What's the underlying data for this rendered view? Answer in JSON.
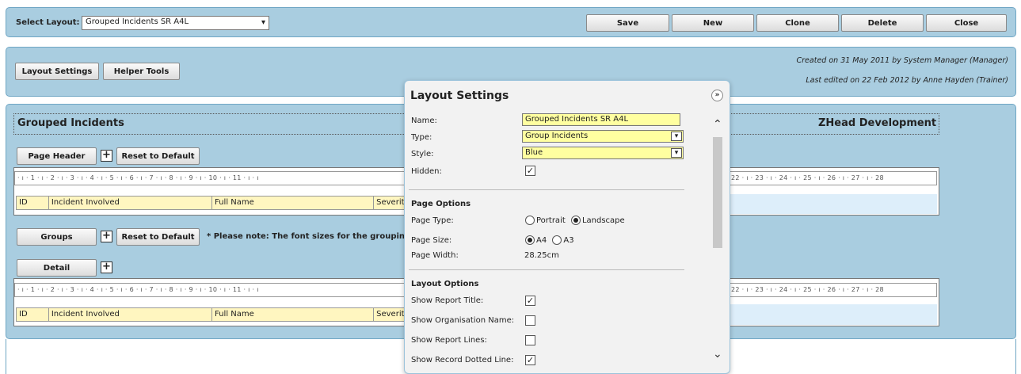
{
  "toolbar": {
    "select_layout_label": "Select Layout:",
    "select_layout_value": "Grouped Incidents SR A4L",
    "save": "Save",
    "new": "New",
    "clone": "Clone",
    "delete": "Delete",
    "close": "Close"
  },
  "info": {
    "layout_settings_btn": "Layout Settings",
    "helper_tools_btn": "Helper Tools",
    "created": "Created on 31 May 2011 by System Manager (Manager)",
    "edited": "Last edited on 22 Feb 2012 by Anne Hayden (Trainer)"
  },
  "report": {
    "title": "Grouped Incidents",
    "org": "ZHead Development",
    "page_header_btn": "Page Header",
    "reset_default": "Reset to Default",
    "groups_btn": "Groups",
    "groups_note": "* Please note: The font sizes for the grouping fi",
    "detail_btn": "Detail",
    "ruler_left": "· ı · 1 · ı · 2 · ı · 3 · ı · 4 · ı · 5 · ı · 6 · ı · 7 · ı · 8 · ı · 9 · ı · 10 · ı · 11 · ı · ı",
    "ruler_right": "22 · ı · 23 · ı · 24 · ı · 25 · ı · 26 · ı · 27 · ı · 28",
    "columns": [
      "ID",
      "Incident Involved",
      "Full Name",
      "Severity"
    ]
  },
  "dialog": {
    "title": "Layout Settings",
    "name_label": "Name:",
    "name_value": "Grouped Incidents SR A4L",
    "type_label": "Type:",
    "type_value": "Group Incidents",
    "style_label": "Style:",
    "style_value": "Blue",
    "hidden_label": "Hidden:",
    "page_options": "Page Options",
    "page_type_label": "Page Type:",
    "portrait": "Portrait",
    "landscape": "Landscape",
    "page_size_label": "Page Size:",
    "a4": "A4",
    "a3": "A3",
    "page_width_label": "Page Width:",
    "page_width_value": "28.25cm",
    "layout_options": "Layout Options",
    "show_report_title": "Show Report Title:",
    "show_org_name": "Show Organisation Name:",
    "show_report_lines": "Show Report Lines:",
    "show_record_dotted": "Show Record Dotted Line:"
  }
}
